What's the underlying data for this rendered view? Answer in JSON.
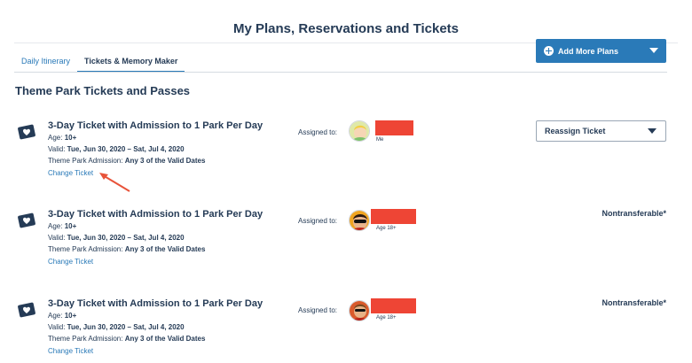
{
  "header": {
    "title": "My Plans, Reservations and Tickets"
  },
  "tabs": [
    {
      "label": "Daily Itinerary",
      "active": false
    },
    {
      "label": "Tickets & Memory Maker",
      "active": true
    }
  ],
  "add_plans": {
    "label": "Add More Plans"
  },
  "section": {
    "title": "Theme Park Tickets and Passes"
  },
  "tickets": [
    {
      "name": "3-Day Ticket with Admission to 1 Park Per Day",
      "age_label": "Age:",
      "age": "10+",
      "valid_label": "Valid:",
      "valid": "Tue, Jun 30, 2020 – Sat, Jul 4, 2020",
      "admission_label": "Theme Park Admission:",
      "admission": "Any 3 of the Valid Dates",
      "change_label": "Change Ticket",
      "assigned_label": "Assigned to:",
      "guest_sub": "Me",
      "action_label": "Reassign Ticket"
    },
    {
      "name": "3-Day Ticket with Admission to 1 Park Per Day",
      "age_label": "Age:",
      "age": "10+",
      "valid_label": "Valid:",
      "valid": "Tue, Jun 30, 2020 – Sat, Jul 4, 2020",
      "admission_label": "Theme Park Admission:",
      "admission": "Any 3 of the Valid Dates",
      "change_label": "Change Ticket",
      "assigned_label": "Assigned to:",
      "guest_sub": "Age 18+",
      "status": "Nontransferable*"
    },
    {
      "name": "3-Day Ticket with Admission to 1 Park Per Day",
      "age_label": "Age:",
      "age": "10+",
      "valid_label": "Valid:",
      "valid": "Tue, Jun 30, 2020 – Sat, Jul 4, 2020",
      "admission_label": "Theme Park Admission:",
      "admission": "Any 3 of the Valid Dates",
      "change_label": "Change Ticket",
      "assigned_label": "Assigned to:",
      "guest_sub": "Age 18+",
      "status": "Nontransferable*"
    }
  ],
  "icons": {
    "ticket": "ticket-heart-icon",
    "add": "plus-circle-icon",
    "dropdown": "chevron-down-icon",
    "annotation": "red-arrow-annotation"
  },
  "colors": {
    "brand_blue": "#2a7ab8",
    "text_navy": "#253b56",
    "redaction": "#ee4535",
    "annotation_arrow": "#e8533a"
  }
}
